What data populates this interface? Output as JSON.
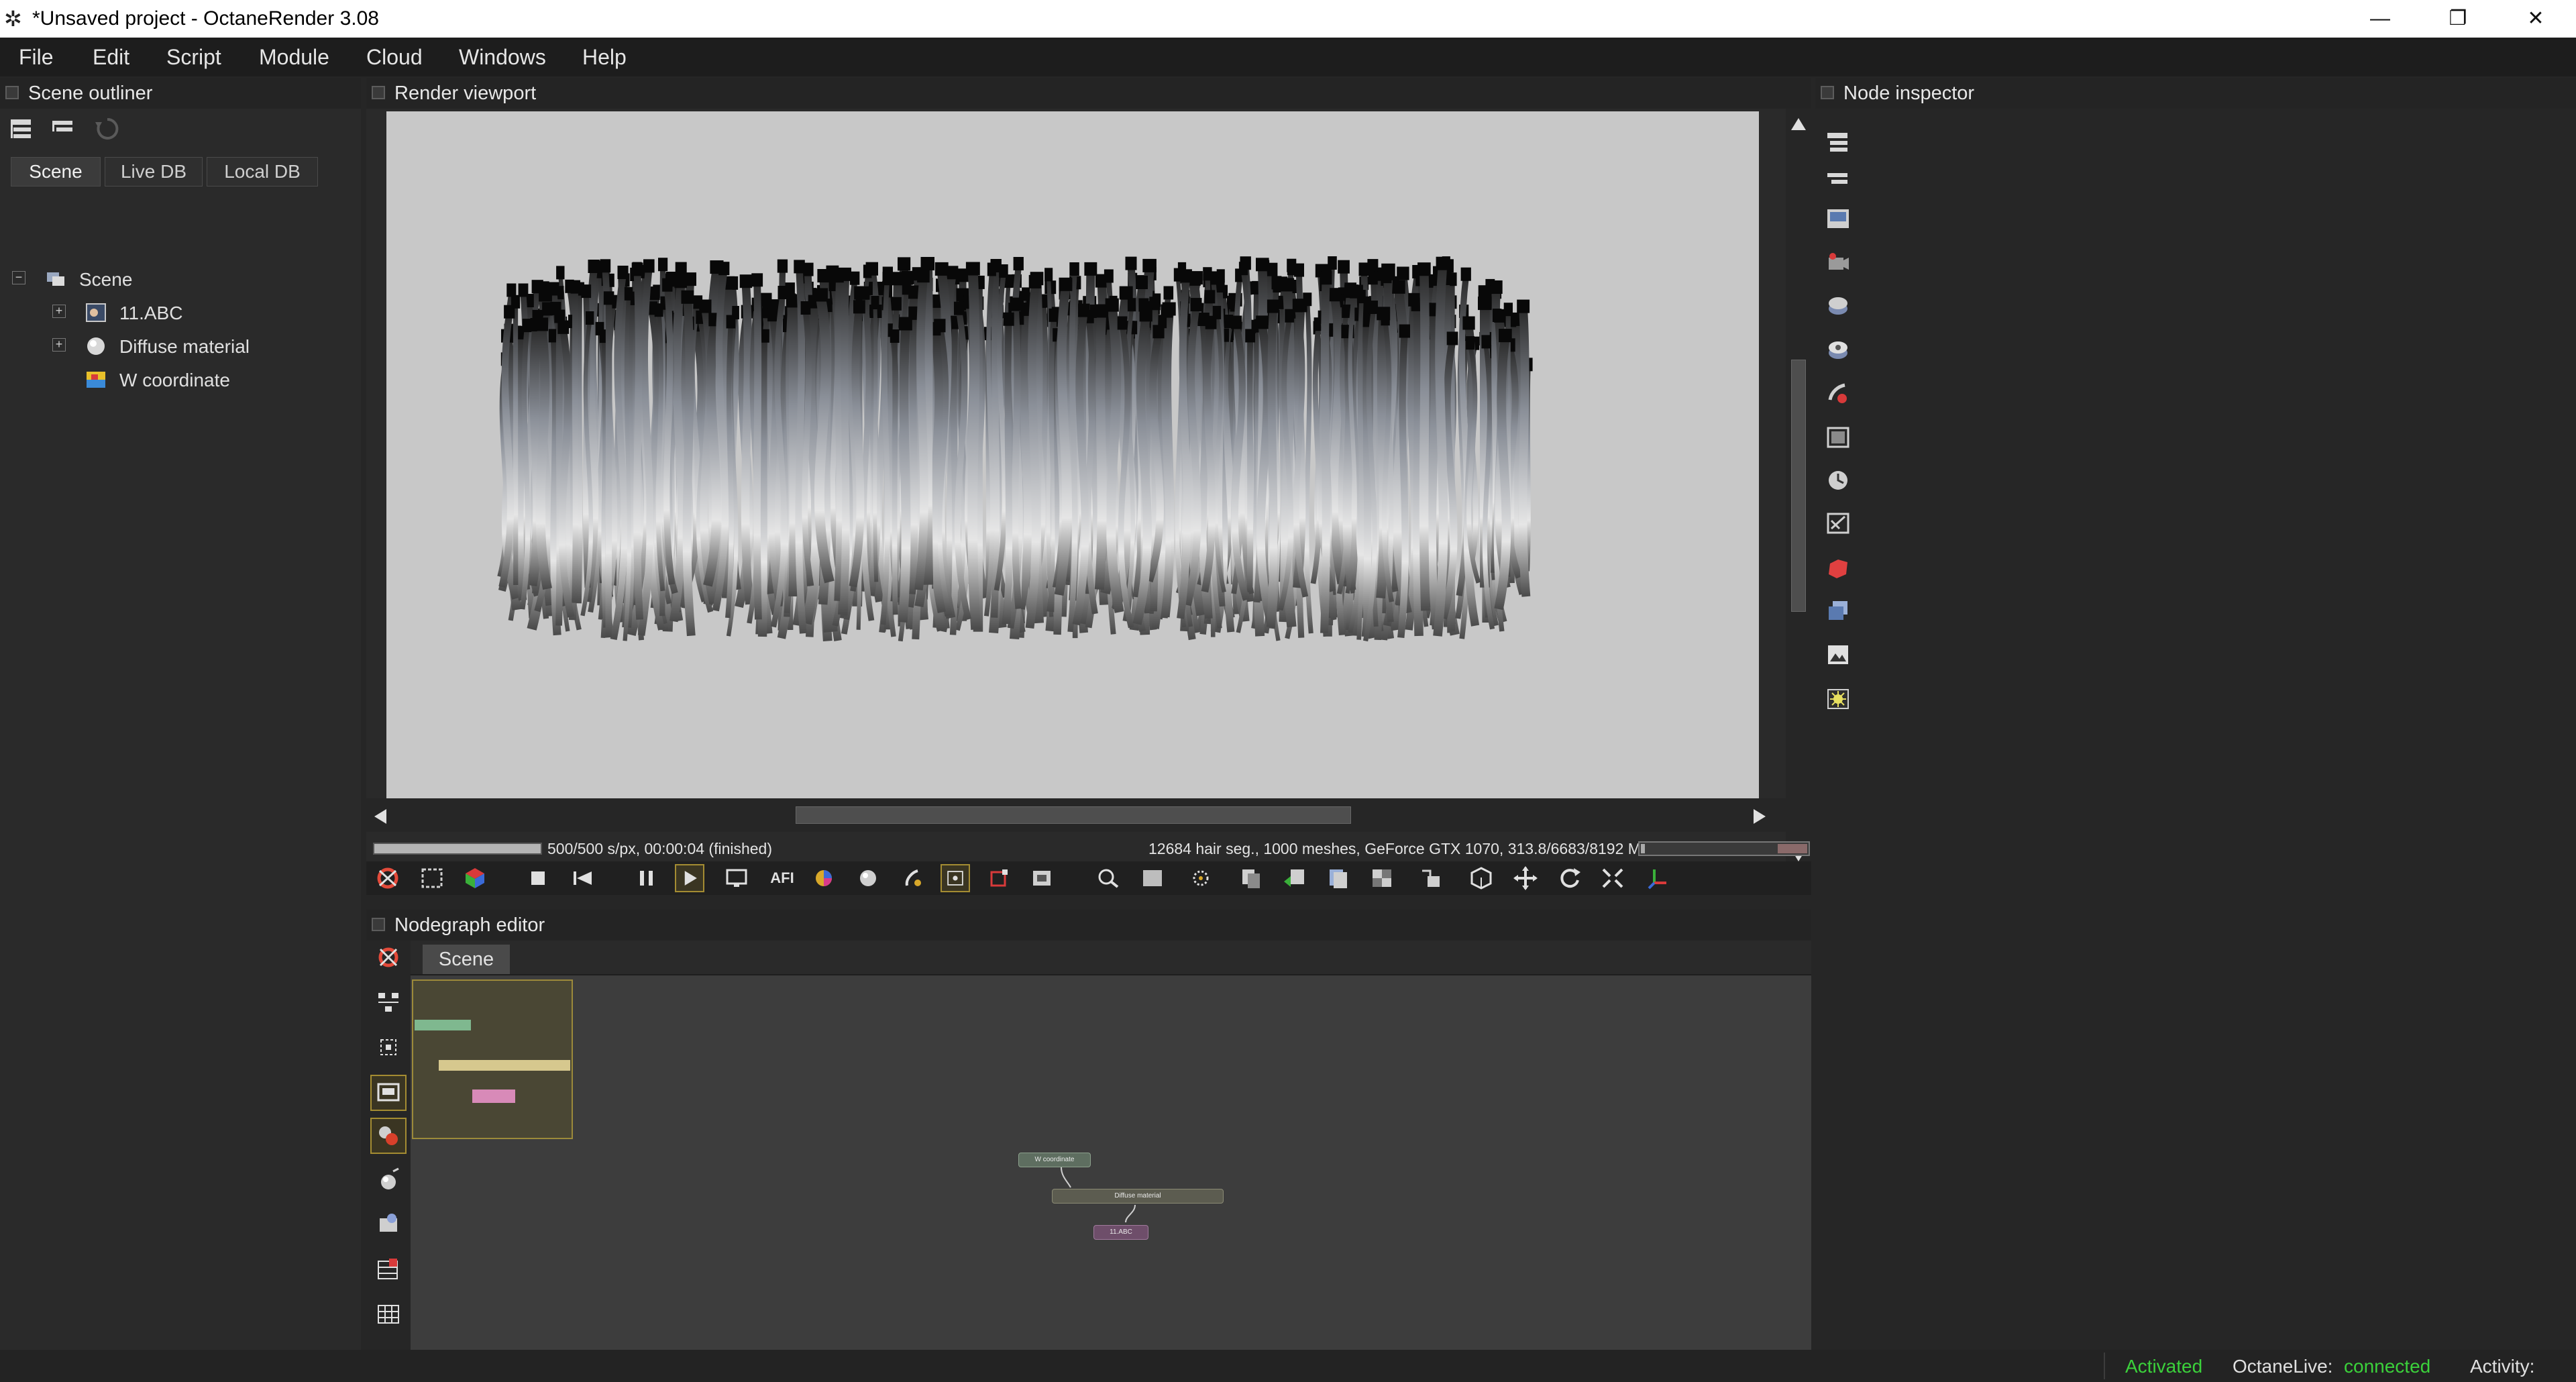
{
  "window": {
    "title": "*Unsaved project - OctaneRender 3.08"
  },
  "menu": [
    "File",
    "Edit",
    "Script",
    "Module",
    "Cloud",
    "Windows",
    "Help"
  ],
  "outliner": {
    "title": "Scene outliner",
    "tabs": [
      "Scene",
      "Live DB",
      "Local DB"
    ],
    "active_tab": "Scene",
    "tree": [
      {
        "label": "Scene",
        "icon": "scene-icon"
      },
      {
        "label": "11.ABC",
        "icon": "geometry-icon"
      },
      {
        "label": "Diffuse material",
        "icon": "material-sphere-icon"
      },
      {
        "label": "W coordinate",
        "icon": "texture-icon"
      }
    ]
  },
  "viewport": {
    "title": "Render viewport",
    "render_progress": 1.0,
    "status_left": "500/500 s/px, 00:00:04 (finished)",
    "status_right": "12684 hair seg., 1000 meshes, GeForce GTX 1070, 313.8/6683/8192 MB",
    "afi_label": "AFI"
  },
  "nodegraph": {
    "title": "Nodegraph editor",
    "tab": "Scene",
    "nodes": [
      {
        "label": "W coordinate",
        "color": "#6a7a6a"
      },
      {
        "label": "Diffuse material",
        "color": "#6a6a5c"
      },
      {
        "label": "11.ABC",
        "color": "#7a5c78"
      }
    ]
  },
  "inspector": {
    "title": "Node inspector"
  },
  "statusbar": {
    "activated": "Activated",
    "live_label": "OctaneLive:",
    "live_status": "connected",
    "activity": "Activity:"
  },
  "colors": {
    "accent_green": "#3bd13b",
    "highlight": "#a48c32",
    "background": "#262626"
  }
}
